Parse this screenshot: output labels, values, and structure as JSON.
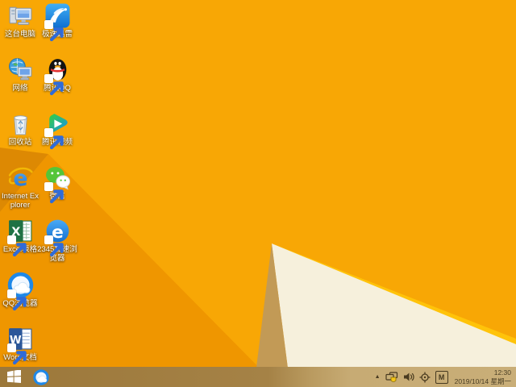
{
  "desktop": {
    "icons": [
      {
        "name": "this-pc",
        "label": "这台电脑"
      },
      {
        "name": "xunlei",
        "label": "极速迅雷"
      },
      {
        "name": "network",
        "label": "网络"
      },
      {
        "name": "tencent-qq",
        "label": "腾讯QQ"
      },
      {
        "name": "recycle-bin",
        "label": "回收站"
      },
      {
        "name": "tencent-video",
        "label": "腾讯视频"
      },
      {
        "name": "internet-explorer",
        "label": "Internet Explorer"
      },
      {
        "name": "wechat",
        "label": "微信"
      },
      {
        "name": "excel",
        "label": "Excel表格"
      },
      {
        "name": "2345-browser",
        "label": "2345加速浏览器"
      },
      {
        "name": "qq-browser",
        "label": "QQ浏览器"
      },
      {
        "name": "word",
        "label": "Word文档"
      }
    ]
  },
  "taskbar": {
    "tray": {
      "hidden_icons_glyph": "▲",
      "ime_letter": "M",
      "time": "12:30",
      "date": "2019/10/14 星期一"
    }
  },
  "colors": {
    "wallpaper_base": "#F8A705",
    "wallpaper_dark_wedge": "#DD8903",
    "wallpaper_mid": "#EF9600",
    "wallpaper_ridge": "#FFC30A",
    "wallpaper_cream": "#F6F0DC",
    "wallpaper_khaki": "#C29A56",
    "taskbar_left": "#9C783A",
    "taskbar_right": "#C9AE78"
  }
}
